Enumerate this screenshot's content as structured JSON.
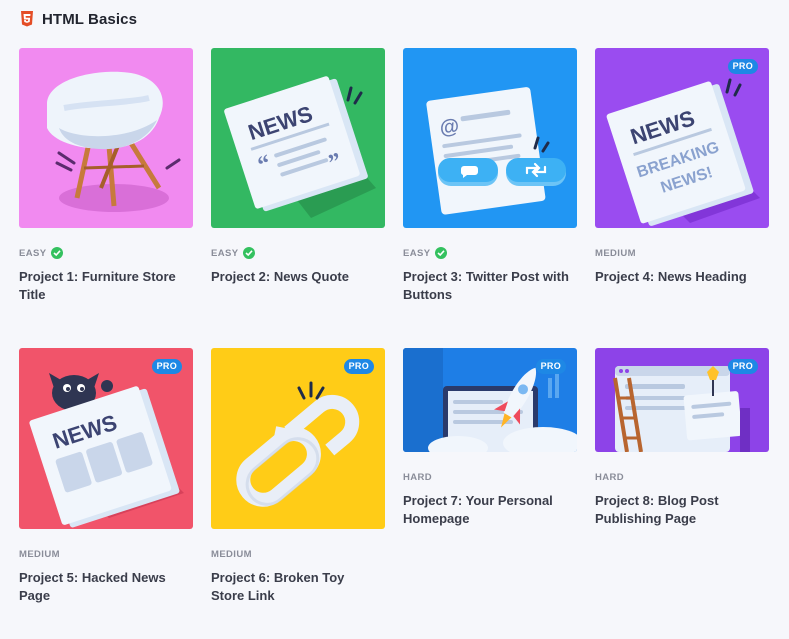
{
  "section": {
    "title": "HTML Basics",
    "icon": "html5-icon",
    "icon_color": "#e44d26"
  },
  "colors": {
    "pro_badge": "#1e88e5",
    "completed_check": "#34c15f"
  },
  "projects": [
    {
      "title": "Project 1: Furniture Store Title",
      "difficulty": "EASY",
      "completed": true,
      "pro": false,
      "thumb_color": "#f18af0",
      "illustration": "chair-illustration"
    },
    {
      "title": "Project 2: News Quote",
      "difficulty": "EASY",
      "completed": true,
      "pro": false,
      "thumb_color": "#33b862",
      "illustration": "newspaper-quote-illustration"
    },
    {
      "title": "Project 3: Twitter Post with Buttons",
      "difficulty": "EASY",
      "completed": true,
      "pro": false,
      "thumb_color": "#2196f3",
      "illustration": "twitter-post-illustration"
    },
    {
      "title": "Project 4: News Heading",
      "difficulty": "MEDIUM",
      "completed": false,
      "pro": true,
      "pro_label": "PRO",
      "thumb_color": "#9a4cf0",
      "illustration": "breaking-news-illustration",
      "newspaper_text": "NEWS",
      "headline_text": "BREAKING NEWS!"
    },
    {
      "title": "Project 5: Hacked News Page",
      "difficulty": "MEDIUM",
      "completed": false,
      "pro": true,
      "pro_label": "PRO",
      "thumb_color": "#f1546a",
      "illustration": "hacked-news-illustration",
      "newspaper_text": "NEWS"
    },
    {
      "title": "Project 6: Broken Toy Store Link",
      "difficulty": "MEDIUM",
      "completed": false,
      "pro": true,
      "pro_label": "PRO",
      "thumb_color": "#ffcc17",
      "illustration": "broken-chain-illustration"
    },
    {
      "title": "Project 7: Your Personal Homepage",
      "difficulty": "HARD",
      "completed": false,
      "pro": true,
      "pro_label": "PRO",
      "thumb_color": "#1e7ee6",
      "illustration": "rocket-launch-illustration"
    },
    {
      "title": "Project 8: Blog Post Publishing Page",
      "difficulty": "HARD",
      "completed": false,
      "pro": true,
      "pro_label": "PRO",
      "thumb_color": "#8d43e8",
      "illustration": "blog-publishing-illustration"
    }
  ],
  "illustration_text": {
    "news": "NEWS"
  }
}
